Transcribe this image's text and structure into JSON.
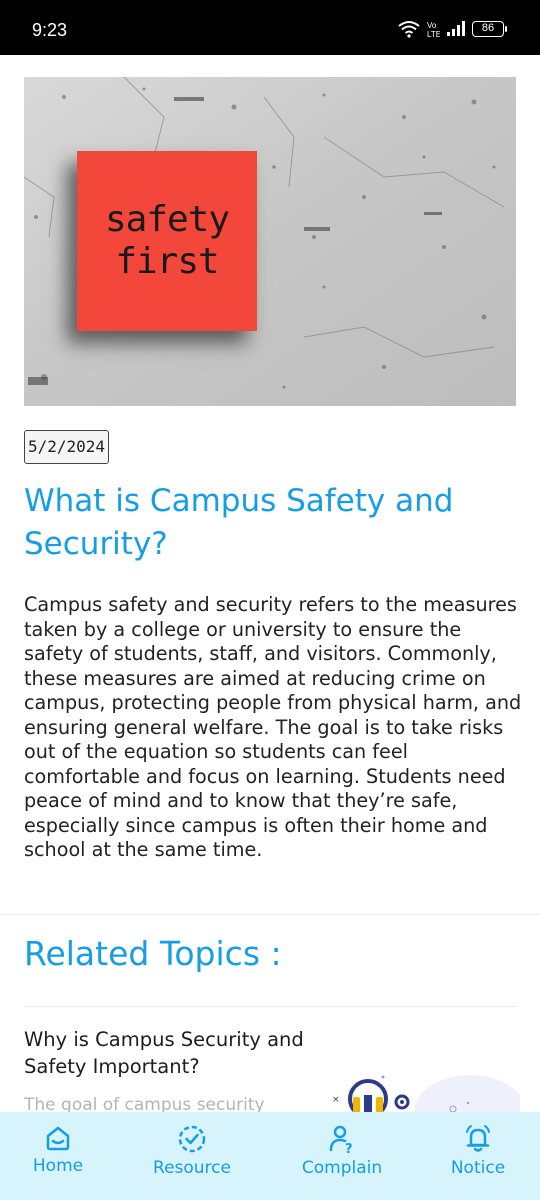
{
  "status_bar": {
    "time": "9:23",
    "battery": "86",
    "icons": [
      "wifi-icon",
      "volte-icon",
      "signal-icon",
      "battery-icon"
    ]
  },
  "hero": {
    "note_line1": "safety",
    "note_line2": "first"
  },
  "article": {
    "date": "5/2/2024",
    "title": "What is Campus Safety and Security?",
    "body": "Campus safety and security refers to the measures taken by a college or university to ensure the safety of students, staff, and visitors. Commonly, these measures are aimed at reducing crime on campus, protecting people from physical harm, and ensuring general welfare. The goal is to take risks out of the equation so students can feel comfortable and focus on learning. Students need peace of mind and to know that they’re safe, especially since campus is often their home and school at the same time."
  },
  "related": {
    "heading": "Related Topics :",
    "items": [
      {
        "title": "Why is Campus Security and Safety Important?",
        "excerpt": "The goal of campus security"
      }
    ]
  },
  "nav": {
    "items": [
      {
        "label": "Home",
        "icon": "home-icon"
      },
      {
        "label": "Resource",
        "icon": "resource-icon"
      },
      {
        "label": "Complain",
        "icon": "complain-icon"
      },
      {
        "label": "Notice",
        "icon": "bell-icon"
      }
    ]
  },
  "colors": {
    "accent": "#159ee6",
    "nav_background": "#d7f3fb",
    "note_red": "#f3473b"
  }
}
